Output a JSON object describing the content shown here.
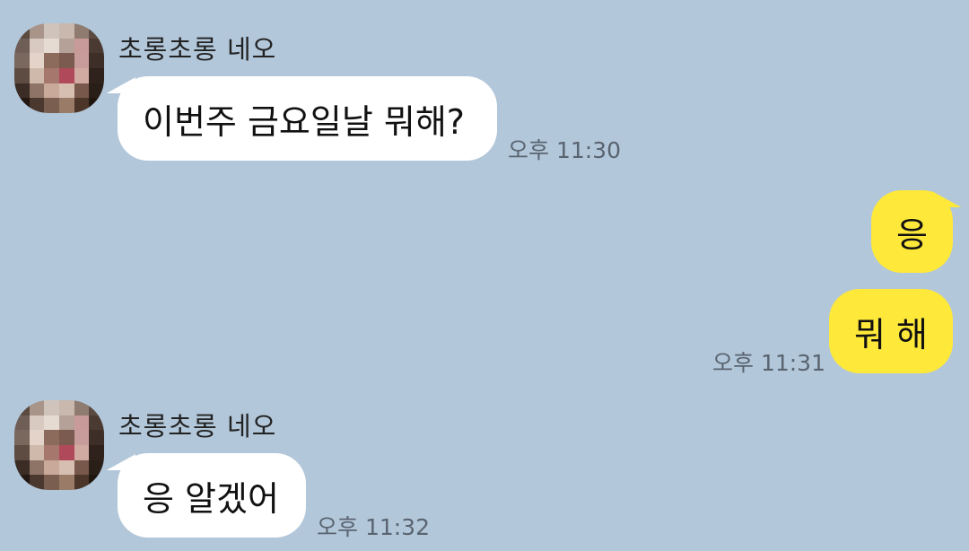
{
  "colors": {
    "background": "#b2c7da",
    "incoming_bubble": "#ffffff",
    "outgoing_bubble": "#fee83a",
    "timestamp": "#5a6470"
  },
  "messages": [
    {
      "sender": "초롱초롱 네오",
      "direction": "incoming",
      "avatar_icon": "blurred-profile-avatar",
      "text": "이번주 금요일날 뭐해?",
      "time": "오후 11:30"
    },
    {
      "direction": "outgoing",
      "text": "응",
      "time": ""
    },
    {
      "direction": "outgoing",
      "text": "뭐 해",
      "time": "오후 11:31"
    },
    {
      "sender": "초롱초롱 네오",
      "direction": "incoming",
      "avatar_icon": "blurred-profile-avatar",
      "text": "응 알겠어",
      "time": "오후 11:32"
    }
  ]
}
